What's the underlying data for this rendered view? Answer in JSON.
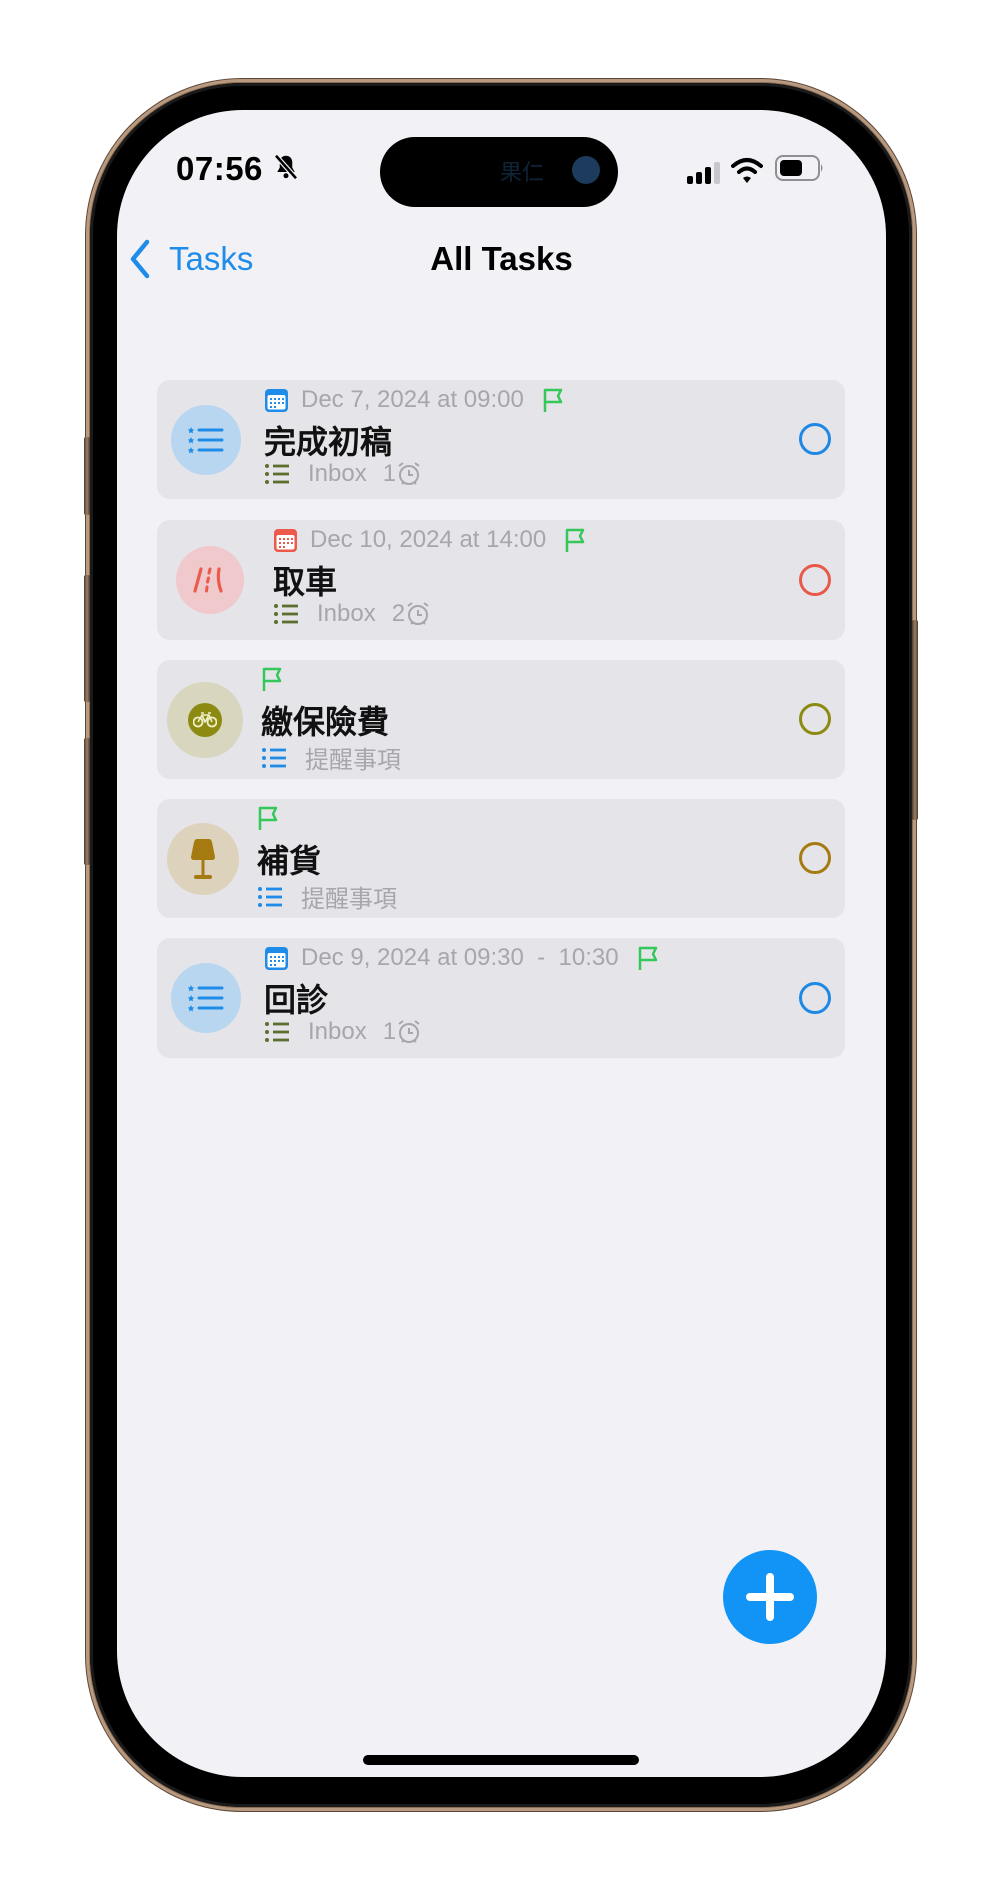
{
  "status_bar": {
    "time": "07:56",
    "silent_icon": "bell-slash-icon",
    "island_watermark": "果仁",
    "signal_icon": "cellular-signal-icon",
    "wifi_icon": "wifi-icon",
    "battery_icon": "battery-icon"
  },
  "nav": {
    "back_label": "Tasks",
    "title": "All Tasks"
  },
  "tasks": [
    {
      "date": "Dec 7, 2024 at 09:00",
      "date_icon_color": "#1E8CE8",
      "flagged": true,
      "title": "完成初稿",
      "list_name": "Inbox",
      "list_icon_color": "#5D6E2E",
      "alarm_count": "1",
      "avatar_icon": "list-icon",
      "avatar_bg": "#B8D6F0",
      "avatar_fg": "#1E8CE8",
      "check_color": "#1E88E5"
    },
    {
      "date": "Dec 10, 2024 at 14:00",
      "date_icon_color": "#EB5A4A",
      "flagged": true,
      "title": "取車",
      "list_name": "Inbox",
      "list_icon_color": "#5D6E2E",
      "alarm_count": "2",
      "avatar_icon": "road-icon",
      "avatar_bg": "#EFC9CB",
      "avatar_fg": "#EB5A4A",
      "check_color": "#E9594A"
    },
    {
      "date": "",
      "flagged": true,
      "title": "繳保險費",
      "list_name": "提醒事項",
      "list_icon_color": "#1E8CE8",
      "alarm_count": "",
      "avatar_icon": "bicycle-icon",
      "avatar_bg": "#D8D6BE",
      "avatar_fg": "#8C8A10",
      "check_color": "#8C8A10"
    },
    {
      "date": "",
      "flagged": true,
      "title": "補貨",
      "list_name": "提醒事項",
      "list_icon_color": "#1E8CE8",
      "alarm_count": "",
      "avatar_icon": "lamp-icon",
      "avatar_bg": "#DDD2BC",
      "avatar_fg": "#A57A10",
      "check_color": "#A57A10"
    },
    {
      "date": "Dec 9, 2024 at 09:30  -  10:30",
      "date_icon_color": "#1E8CE8",
      "flagged": true,
      "title": "回診",
      "list_name": "Inbox",
      "list_icon_color": "#5D6E2E",
      "alarm_count": "1",
      "avatar_icon": "list-icon",
      "avatar_bg": "#B8D6F0",
      "avatar_fg": "#1E8CE8",
      "check_color": "#1E88E5"
    }
  ],
  "colors": {
    "accent": "#1E8CE8",
    "flag": "#34C759",
    "fab": "#1194F5"
  },
  "fab": {
    "icon": "plus-icon",
    "label": "Add task"
  }
}
